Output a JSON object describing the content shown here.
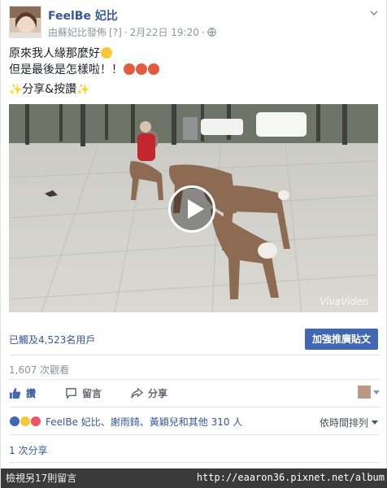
{
  "post": {
    "author": "FeelBe 妃比",
    "byline": "由蘇妃比發佈",
    "byline_tag": "[?]",
    "date": "2月22日 19:20",
    "message_lines": [
      "原來我人緣那麼好",
      "但是最後是怎樣啦！！",
      "分享&按讚"
    ]
  },
  "video": {
    "watermark": "VivaVideo"
  },
  "reach": {
    "text": "已觸及4,523名用戶",
    "boost_label": "加強推廣貼文"
  },
  "stats": {
    "views": "1,607 次觀看",
    "reactions_text": "FeelBe 妃比、謝雨錡、黃穎兒和其他 310 人",
    "sort_label": "依時間排列",
    "shares": "1 次分享",
    "more_comments": "檢視另17則留言"
  },
  "actions": {
    "like": "讚",
    "comment": "留言",
    "share": "分享"
  },
  "overlay": {
    "url": "http://eaaron36.pixnet.net/album"
  },
  "colors": {
    "link": "#365899",
    "boost": "#4267b2",
    "muted": "#90949c"
  }
}
